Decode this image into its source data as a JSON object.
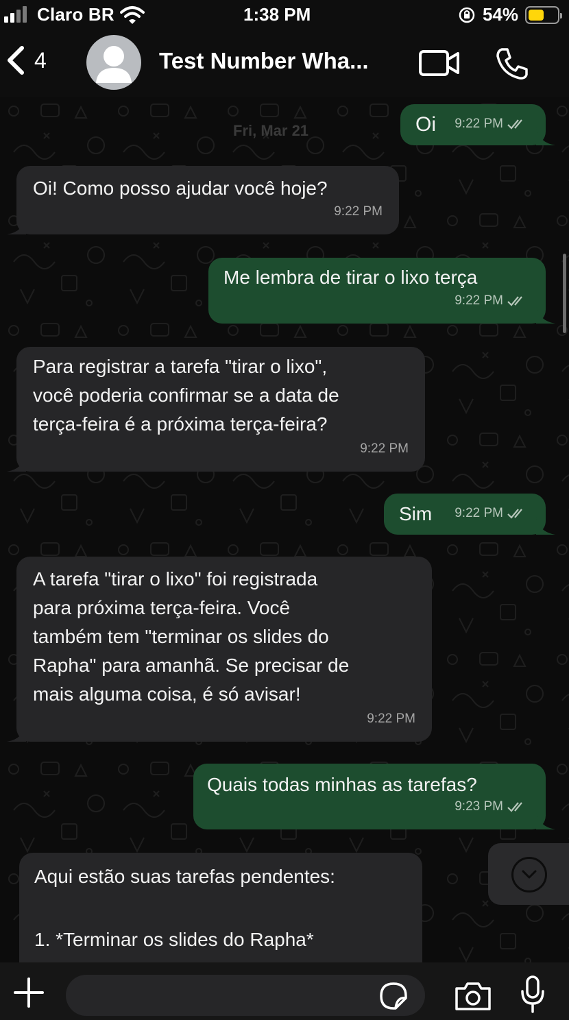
{
  "status_bar": {
    "carrier": "Claro BR",
    "time": "1:38 PM",
    "battery_percent": "54%",
    "battery_level": 0.54
  },
  "header": {
    "back_count": "4",
    "contact_name": "Test Number Wha..."
  },
  "chat": {
    "date_chip": "Fri, Mar 21",
    "messages": [
      {
        "direction": "out",
        "text": "Oi",
        "time": "9:22 PM"
      },
      {
        "direction": "in",
        "text": "Oi! Como posso ajudar você hoje?",
        "time": "9:22 PM"
      },
      {
        "direction": "out",
        "text": "Me lembra de tirar o lixo terça",
        "time": "9:22 PM"
      },
      {
        "direction": "in",
        "text": "Para registrar a tarefa \"tirar o lixo\",\nvocê poderia confirmar se a data de\nterça-feira é a próxima terça-feira?",
        "time": "9:22 PM"
      },
      {
        "direction": "out",
        "text": "Sim",
        "time": "9:22 PM"
      },
      {
        "direction": "in",
        "text": "A tarefa \"tirar o lixo\" foi registrada\npara próxima terça-feira. Você\ntambém tem \"terminar os slides do\nRapha\" para amanhã. Se precisar de\nmais alguma coisa, é só avisar!",
        "time": "9:22 PM"
      },
      {
        "direction": "out",
        "text": "Quais todas minhas as tarefas?",
        "time": "9:23 PM"
      },
      {
        "direction": "in",
        "text": "Aqui estão suas tarefas pendentes:\n\n1. *Terminar os slides do Rapha*",
        "time": ""
      }
    ]
  },
  "input_bar": {
    "placeholder": ""
  },
  "colors": {
    "incoming_bubble": "#262628",
    "outgoing_bubble": "#1d4d2f",
    "background": "#0c0c0c"
  },
  "icons": [
    "signal-icon",
    "wifi-icon",
    "orientation-lock-icon",
    "battery-icon",
    "back-chevron-icon",
    "avatar-icon",
    "video-call-icon",
    "phone-icon",
    "read-receipt-icon",
    "scroll-down-chevron-icon",
    "plus-icon",
    "sticker-icon",
    "camera-icon",
    "microphone-icon"
  ]
}
